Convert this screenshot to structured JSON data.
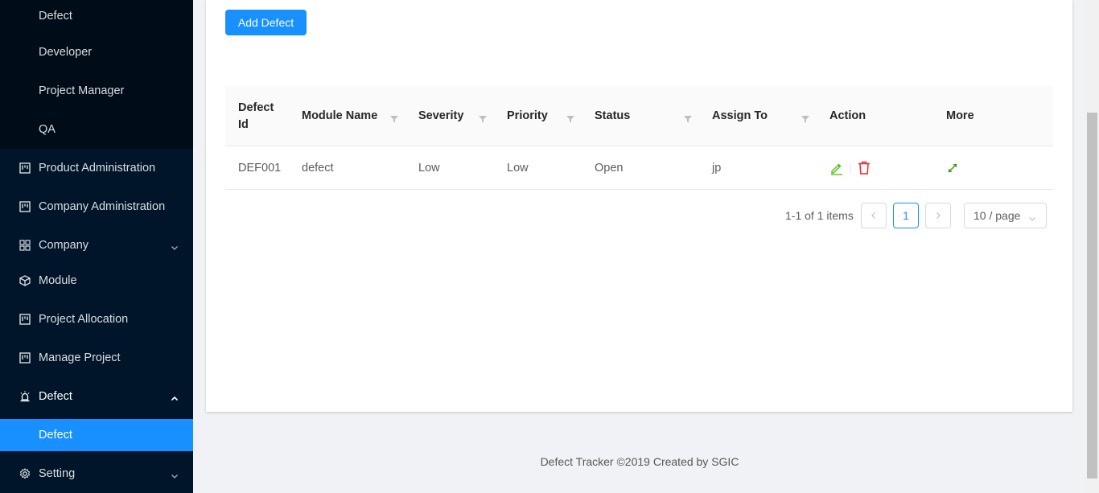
{
  "sidebar": {
    "sub_items_top": [
      {
        "label": "Defect"
      },
      {
        "label": "Developer"
      },
      {
        "label": "Project Manager"
      },
      {
        "label": "QA"
      }
    ],
    "items": [
      {
        "label": "Product Administration",
        "icon": "project-icon"
      },
      {
        "label": "Company Administration",
        "icon": "project-icon"
      },
      {
        "label": "Company",
        "icon": "appstore-icon"
      },
      {
        "label": "Module",
        "icon": "code-sandbox-icon"
      },
      {
        "label": "Project Allocation",
        "icon": "project-icon"
      },
      {
        "label": "Manage Project",
        "icon": "project-icon"
      },
      {
        "label": "Defect",
        "icon": "alert-icon"
      },
      {
        "label": "Defect"
      },
      {
        "label": "Setting",
        "icon": "setting-icon"
      }
    ]
  },
  "toolbar": {
    "add_label": "Add Defect"
  },
  "table": {
    "columns": [
      "Defect Id",
      "Module Name",
      "Severity",
      "Priority",
      "Status",
      "Assign To",
      "Action",
      "More"
    ],
    "rows": [
      {
        "defect_id": "DEF001",
        "module_name": "defect",
        "severity": "Low",
        "priority": "Low",
        "status": "Open",
        "assign_to": "jp"
      }
    ]
  },
  "pagination": {
    "total_text": "1-1 of 1 items",
    "current_page": "1",
    "page_size": "10 / page"
  },
  "footer": {
    "text": "Defect Tracker ©2019 Created by SGIC"
  },
  "colors": {
    "primary": "#1890ff",
    "sider": "#001529",
    "edit": "#52c41a",
    "delete": "#f5222d"
  }
}
